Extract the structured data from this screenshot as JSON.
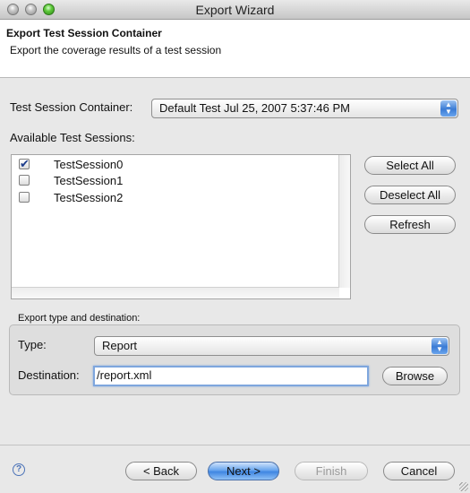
{
  "window": {
    "title": "Export Wizard"
  },
  "banner": {
    "title": "Export Test Session Container",
    "description": "Export the coverage results of a test session"
  },
  "container": {
    "label": "Test Session Container:",
    "selected": "Default Test Jul 25, 2007 5:37:46 PM"
  },
  "sessions": {
    "label": "Available Test Sessions:",
    "items": [
      {
        "name": "TestSession0",
        "checked": true
      },
      {
        "name": "TestSession1",
        "checked": false
      },
      {
        "name": "TestSession2",
        "checked": false
      }
    ],
    "buttons": {
      "select_all": "Select All",
      "deselect_all": "Deselect All",
      "refresh": "Refresh"
    }
  },
  "export": {
    "group_label": "Export type and destination:",
    "type_label": "Type:",
    "type_value": "Report",
    "destination_label": "Destination:",
    "destination_value": "/report.xml",
    "browse": "Browse"
  },
  "footer": {
    "help": "?",
    "back": "< Back",
    "next": "Next >",
    "finish": "Finish",
    "cancel": "Cancel"
  },
  "icons": {
    "checkmark": "✔",
    "combo_arrow": "▲▼"
  }
}
